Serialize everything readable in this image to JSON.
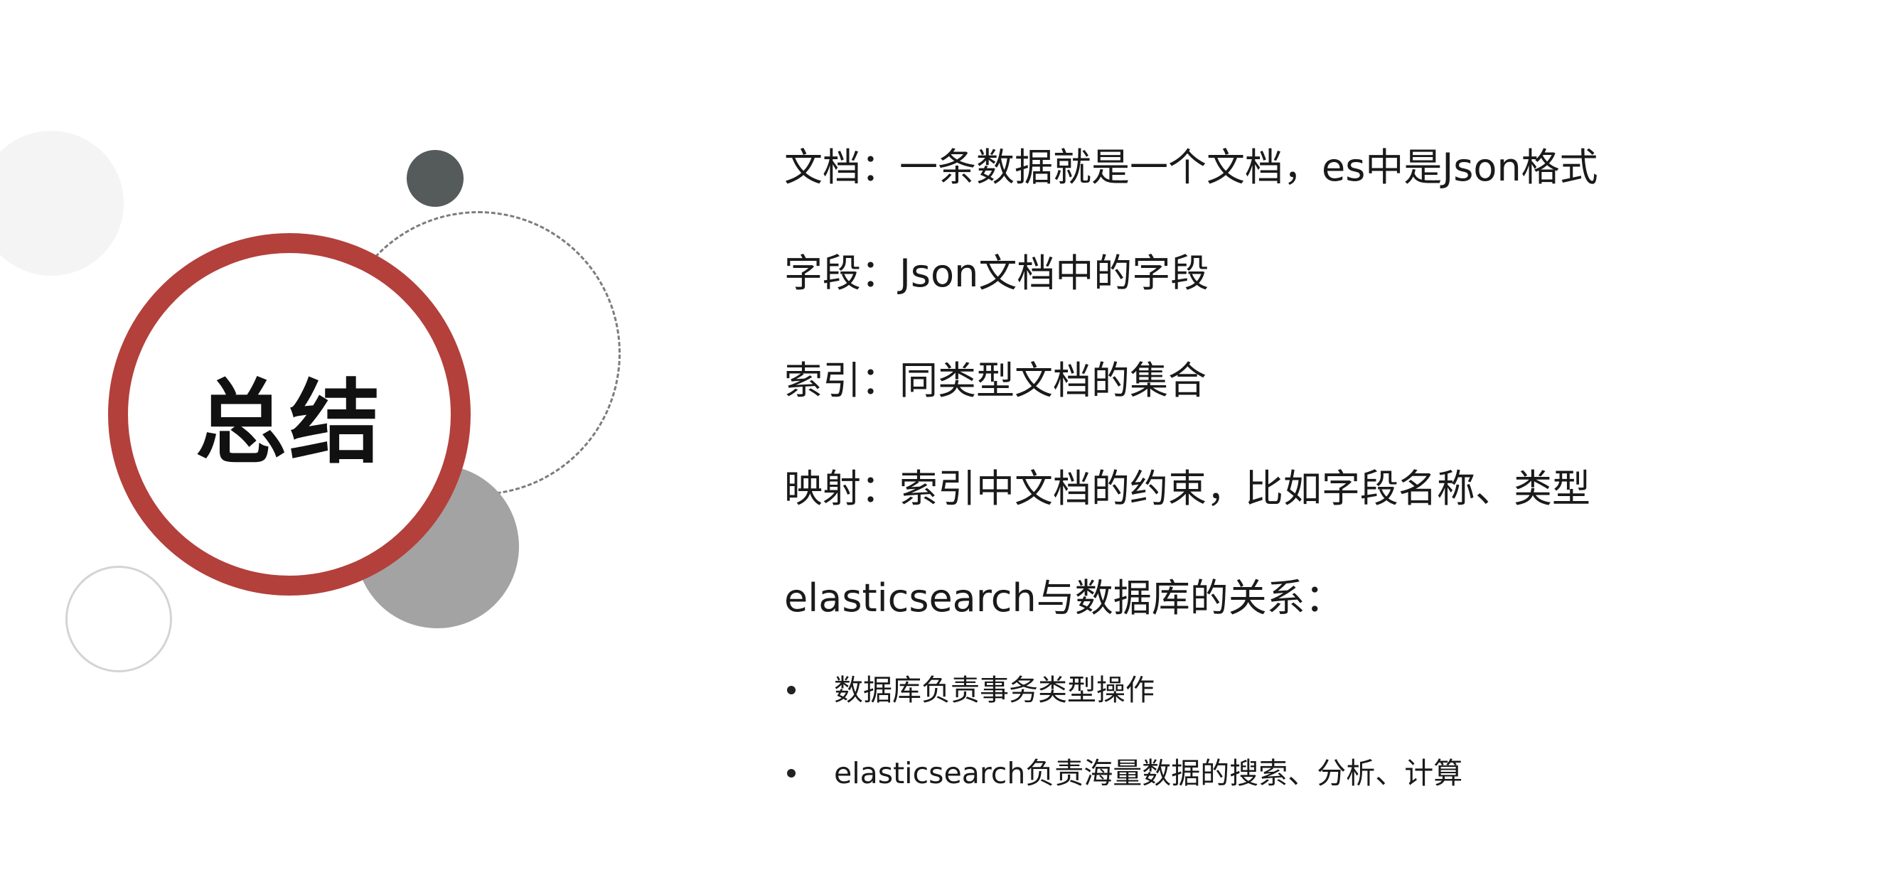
{
  "slide": {
    "title": "总结",
    "lines": [
      "文档：一条数据就是一个文档，es中是Json格式",
      "字段：Json文档中的字段",
      "索引：同类型文档的集合",
      "映射：索引中文档的约束，比如字段名称、类型",
      "elasticsearch与数据库的关系："
    ],
    "bullets": [
      "数据库负责事务类型操作",
      "elasticsearch负责海量数据的搜索、分析、计算"
    ]
  },
  "colors": {
    "accent_red": "#b3403b",
    "dark_dot": "#555a5a",
    "gray_circle": "#a3a3a3",
    "light_circle": "#f4f4f4",
    "dashed_circle": "#7c7c7c",
    "outline_circle": "#d4d4d4"
  }
}
